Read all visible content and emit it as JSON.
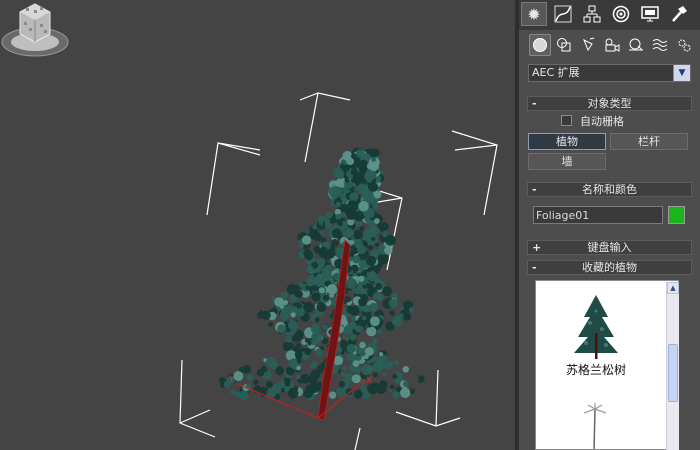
{
  "command_panel": {
    "tabs": [
      {
        "name": "create-tab",
        "icon": "sun-gear-icon",
        "active": true
      },
      {
        "name": "modify-tab",
        "icon": "modify-curve-icon",
        "active": false
      },
      {
        "name": "hierarchy-tab",
        "icon": "hierarchy-icon",
        "active": false
      },
      {
        "name": "motion-tab",
        "icon": "motion-circle-icon",
        "active": false
      },
      {
        "name": "display-tab",
        "icon": "monitor-icon",
        "active": false
      },
      {
        "name": "utilities-tab",
        "icon": "hammer-icon",
        "active": false
      }
    ],
    "category_icons": [
      "geometry-icon",
      "shapes-icon",
      "lights-icon",
      "cameras-icon",
      "helpers-icon",
      "spacewarps-icon",
      "systems-icon"
    ],
    "dropdown": {
      "selected": "AEC 扩展"
    },
    "object_type": {
      "header": "对象类型",
      "collapse_sign": "-",
      "autogrid_label": "自动栅格",
      "autogrid_checked": false,
      "buttons": [
        {
          "label": "植物",
          "active": true
        },
        {
          "label": "栏杆",
          "active": false
        },
        {
          "label": "墙",
          "active": false
        }
      ]
    },
    "name_color": {
      "header": "名称和颜色",
      "collapse_sign": "-",
      "name_value": "Foliage01",
      "color": "#1bb41b"
    },
    "keyboard_entry": {
      "header": "键盘输入",
      "collapse_sign": "+"
    },
    "favorite_plants": {
      "header": "收藏的植物",
      "collapse_sign": "-",
      "items": [
        {
          "label": "苏格兰松树"
        }
      ]
    }
  },
  "colors": {
    "viewport_bg": "#444444",
    "tree_foliage": "#1f4a45",
    "trunk": "#7a1a1a",
    "bounding_box": "#ffffff"
  }
}
